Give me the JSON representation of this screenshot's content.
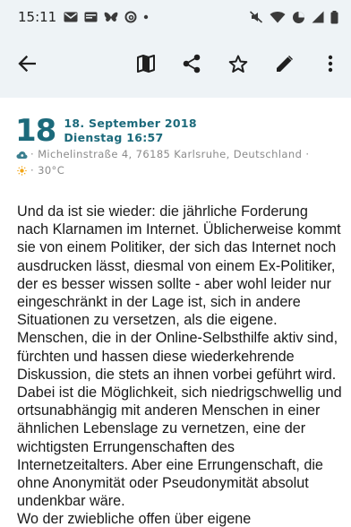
{
  "status_bar": {
    "time": "15:11",
    "notification_icons": [
      "gmail-icon",
      "email-icon",
      "bluesky-icon",
      "threads-icon",
      "dot-icon"
    ],
    "system_icons": [
      "mute-icon",
      "wifi-icon",
      "data-saver-icon",
      "signal-icon",
      "battery-icon"
    ]
  },
  "app_bar": {
    "back_icon": "arrow-left-icon",
    "actions": [
      "map-icon",
      "share-icon",
      "star-icon",
      "edit-icon",
      "more-vert-icon"
    ]
  },
  "entry": {
    "day": "18",
    "date": "18. September 2018",
    "weekday_time": "Dienstag 16:57",
    "location": "· Michelinstraße 4, 76185 Karlsruhe, Deutschland ·",
    "temperature": "· 30°C",
    "body": "Und da ist sie wieder: die jährliche Forderung nach Klarnamen im Internet. Üblicherweise kommt sie von einem Politiker, der sich das Internet noch ausdrucken lässt, diesmal von einem Ex-Politiker, der es besser wissen sollte - aber wohl leider nur eingeschränkt in der Lage ist, sich in andere Situationen zu versetzen, als die eigene.\nMenschen, die in der Online-Selbsthilfe aktiv sind, fürchten und hassen diese wiederkehrende Diskussion, die stets an ihnen vorbei geführt wird. Dabei ist die Möglichkeit, sich niedrigschwellig und ortsunabhängig mit anderen Menschen in einer ähnlichen Lebenslage zu vernetzen, eine der wichtigsten Errungenschaften des Internetzeitalters. Aber eine Errungenschaft, die ohne Anonymität oder Pseudonymität absolut undenkbar wäre.\nWo der zwiebliche offen über eigene"
  },
  "colors": {
    "accent": "#1c6a7b",
    "bar_background": "#eef3f6",
    "meta_text": "#8a8a8a"
  }
}
